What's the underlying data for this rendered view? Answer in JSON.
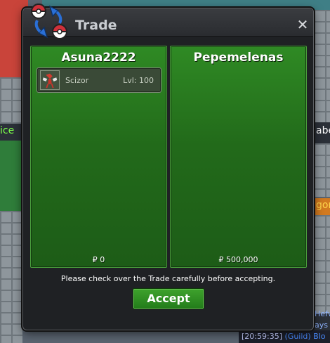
{
  "window": {
    "title": "Trade",
    "close_label": "✕"
  },
  "left_panel": {
    "player_name": "Asuna2222",
    "pokemon": {
      "name": "Scizor",
      "level": "Lvl: 100"
    },
    "money": "₽ 0"
  },
  "right_panel": {
    "player_name": "Pepemelenas",
    "money": "₽ 500,000"
  },
  "notice": "Please check over the Trade carefully before accepting.",
  "accept_label": "Accept",
  "world": {
    "text_ice": "ice",
    "text_abe": "abe",
    "text_gon": "gon",
    "text_hef": "Hefv",
    "text_ays": "ays",
    "chat_time": "[20:59:35]",
    "chat_guild": "(Guild) Blo"
  },
  "colors": {
    "panel_green": "#2f8a24",
    "accept_green": "#3ea22d",
    "window_bg": "#1f2124"
  },
  "icons": {
    "logo": "pokeball-trade-icon",
    "close": "close-icon",
    "pokemon": "scizor-sprite-icon"
  }
}
